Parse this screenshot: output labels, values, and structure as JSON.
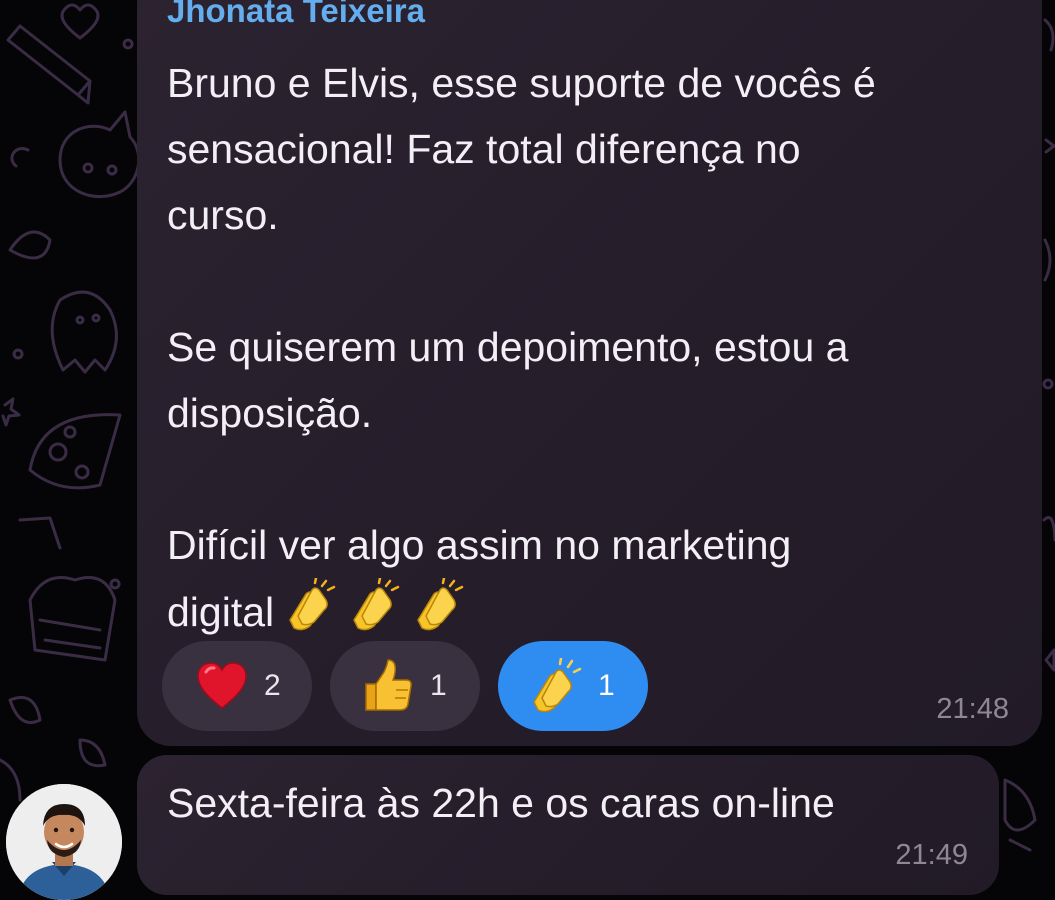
{
  "colors": {
    "background": "#050406",
    "bubble": "#2a2130",
    "sender_name": "#64aef0",
    "reaction_pill": "#3a3140",
    "reaction_pill_active": "#2f8df2",
    "timestamp": "#8f8794"
  },
  "messages": [
    {
      "sender": "Jhonata Teixeira",
      "lines": [
        "Bruno e Elvis, esse suporte de vocês é",
        "sensacional! Faz total diferença no",
        "curso.",
        "",
        "Se quiserem um depoimento, estou a",
        "disposição.",
        "",
        "Difícil ver algo assim no marketing",
        "digital"
      ],
      "trailing_emoji": [
        "clapping-hands",
        "clapping-hands",
        "clapping-hands"
      ],
      "reactions": [
        {
          "icon": "red-heart",
          "count": "2",
          "active": false
        },
        {
          "icon": "thumbs-up",
          "count": "1",
          "active": false
        },
        {
          "icon": "clapping-hands",
          "count": "1",
          "active": true
        }
      ],
      "time": "21:48"
    },
    {
      "sender": "",
      "text": "Sexta-feira às 22h e os caras on-line",
      "time": "21:49",
      "avatar": "user-avatar-photo"
    }
  ]
}
